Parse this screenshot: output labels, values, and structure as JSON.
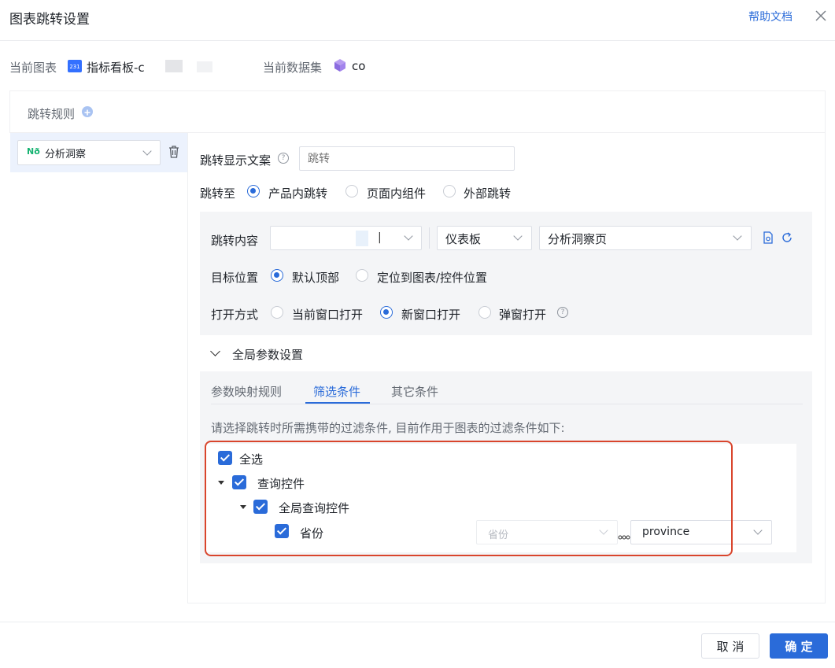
{
  "dialog": {
    "title": "图表跳转设置",
    "help_link": "帮助文档",
    "current_chart_label": "当前图表",
    "current_chart_icon_text": "231",
    "current_chart_value": "指标看板-c",
    "current_dataset_label": "当前数据集",
    "current_dataset_value": "co"
  },
  "rules": {
    "header": "跳转规则",
    "items": [
      {
        "label": "分析洞察",
        "icon_text": "Nð"
      }
    ]
  },
  "form": {
    "display_text_label": "跳转显示文案",
    "display_text_placeholder": "跳转",
    "jump_to_label": "跳转至",
    "jump_to_options": [
      "产品内跳转",
      "页面内组件",
      "外部跳转"
    ],
    "jump_to_selected": 0,
    "content_label": "跳转内容",
    "content_select1_value": "",
    "content_select2_value": "仪表板",
    "content_select3_value": "分析洞察页",
    "target_label": "目标位置",
    "target_options": [
      "默认顶部",
      "定位到图表/控件位置"
    ],
    "target_selected": 0,
    "open_label": "打开方式",
    "open_options": [
      "当前窗口打开",
      "新窗口打开",
      "弹窗打开"
    ],
    "open_selected": 1
  },
  "params": {
    "section_title": "全局参数设置",
    "tabs": [
      "参数映射规则",
      "筛选条件",
      "其它条件"
    ],
    "active_tab": 1,
    "description": "请选择跳转时所需携带的过滤条件, 目前作用于图表的过滤条件如下:",
    "tree": {
      "select_all": "全选",
      "group": "查询控件",
      "subgroup": "全局查询控件",
      "item": "省份",
      "item_select_value": "省份",
      "item_field_value": "province"
    }
  },
  "footer": {
    "cancel_label": "取 消",
    "ok_label": "确 定"
  },
  "colors": {
    "primary": "#2a6bd9",
    "highlight_border": "#d9452c"
  }
}
